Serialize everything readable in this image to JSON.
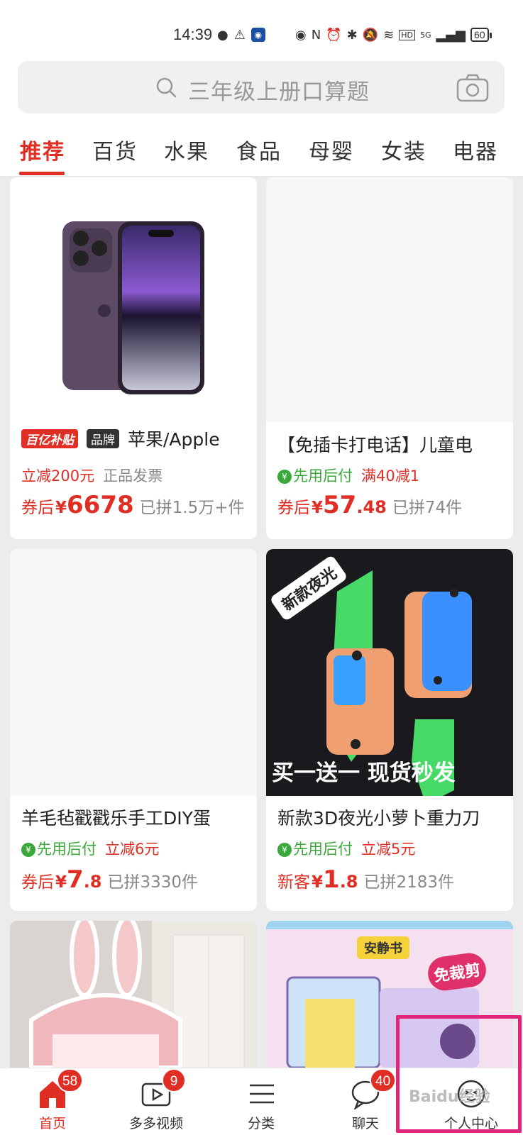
{
  "status_bar": {
    "time": "14:39",
    "battery": "60",
    "signal": "5G"
  },
  "search": {
    "placeholder": "三年级上册口算题",
    "icon": "search-icon",
    "camera_icon": "camera-icon"
  },
  "tabs": [
    {
      "label": "推荐",
      "active": true
    },
    {
      "label": "百货"
    },
    {
      "label": "水果"
    },
    {
      "label": "食品"
    },
    {
      "label": "母婴"
    },
    {
      "label": "女装"
    },
    {
      "label": "电器"
    }
  ],
  "products": [
    {
      "badges": [
        "百亿补贴",
        "品牌"
      ],
      "title": "苹果/Apple",
      "tags": [
        "立减200元",
        "正品发票"
      ],
      "price_prefix": "券后",
      "yen": "¥",
      "price_int": "6678",
      "price_dec": "",
      "sold": "已拼1.5万+件"
    },
    {
      "title": "【免插卡打电话】儿童电",
      "tags": [
        "先用后付",
        "满40减1"
      ],
      "price_prefix": "券后",
      "yen": "¥",
      "price_int": "57",
      "price_dec": ".48",
      "sold": "已拼74件"
    },
    {
      "title": "羊毛毡戳戳乐手工DIY蛋",
      "tags": [
        "先用后付",
        "立减6元"
      ],
      "price_prefix": "券后",
      "yen": "¥",
      "price_int": "7",
      "price_dec": ".8",
      "sold": "已拼3330件"
    },
    {
      "image_text": [
        "新款夜光",
        "买一送一 现货秒发"
      ],
      "title": "新款3D夜光小萝卜重力刀",
      "tags": [
        "先用后付",
        "立减5元"
      ],
      "price_prefix": "新客",
      "yen": "¥",
      "price_int": "1",
      "price_dec": ".8",
      "sold": "已拼2183件"
    },
    {
      "title": ""
    },
    {
      "image_text": [
        "安静书",
        "免裁剪"
      ]
    }
  ],
  "tabbar": [
    {
      "label": "首页",
      "icon": "home-icon",
      "badge": "58",
      "active": true
    },
    {
      "label": "多多视频",
      "icon": "video-icon",
      "badge": "9"
    },
    {
      "label": "分类",
      "icon": "category-list-icon"
    },
    {
      "label": "聊天",
      "icon": "chat-bubble-icon",
      "badge": "40"
    },
    {
      "label": "个人中心",
      "icon": "profile-face-icon"
    }
  ],
  "watermark": "Baidu经验",
  "colors": {
    "accent": "#e02e24",
    "green": "#3aa83a",
    "highlight": "#e0267a"
  }
}
